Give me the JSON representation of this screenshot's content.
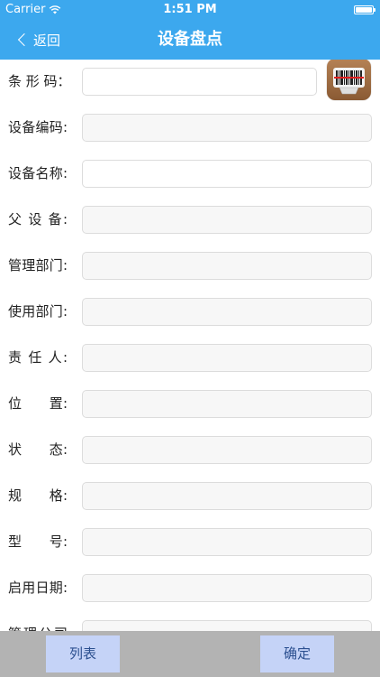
{
  "status_bar": {
    "carrier": "Carrier",
    "time": "1:51 PM"
  },
  "nav": {
    "back_label": "返回",
    "title": "设备盘点"
  },
  "form": {
    "fields": [
      {
        "label": "条 形 码：",
        "value": "",
        "editable": true,
        "has_scan_button": true
      },
      {
        "label": "设备编码:",
        "value": "",
        "editable": false
      },
      {
        "label": "设备名称:",
        "value": "",
        "editable": true
      },
      {
        "label": "父 设 备:",
        "value": "",
        "editable": false
      },
      {
        "label": "管理部门:",
        "value": "",
        "editable": false
      },
      {
        "label": "使用部门:",
        "value": "",
        "editable": false
      },
      {
        "label": "责 任 人:",
        "value": "",
        "editable": false
      },
      {
        "label": "位　　置:",
        "value": "",
        "editable": false
      },
      {
        "label": "状　　态:",
        "value": "",
        "editable": false
      },
      {
        "label": "规　　格:",
        "value": "",
        "editable": false
      },
      {
        "label": "型　　号:",
        "value": "",
        "editable": false
      },
      {
        "label": "启用日期:",
        "value": "",
        "editable": false
      },
      {
        "label": "管理公司",
        "value": "",
        "editable": false
      }
    ]
  },
  "bottom": {
    "list_label": "列表",
    "confirm_label": "确定"
  },
  "colors": {
    "nav_bar": "#3ca8ee",
    "bottom_bar": "#b3b3b3",
    "button_bg": "#c5d3f7",
    "button_text": "#2b4f8f"
  }
}
